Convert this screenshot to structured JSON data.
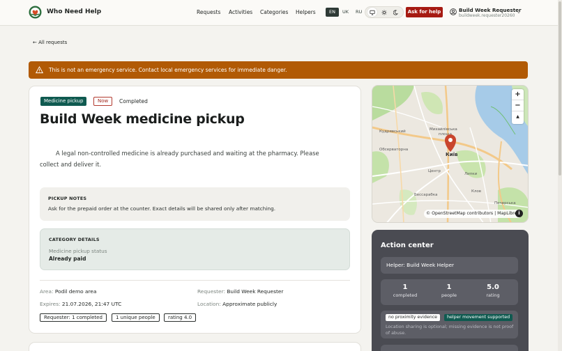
{
  "header": {
    "brand": "Who Need Help",
    "nav": [
      "Requests",
      "Activities",
      "Categories",
      "Helpers"
    ],
    "languages": [
      {
        "code": "EN",
        "active": true
      },
      {
        "code": "UK",
        "active": false
      },
      {
        "code": "RU",
        "active": false
      }
    ],
    "theme_icons": [
      "monitor-icon",
      "sun-icon",
      "moon-icon"
    ],
    "ask_label": "Ask for help",
    "user_name": "Build Week Requester",
    "user_email": "buildweek.requester20260...",
    "accent": "#a61a12"
  },
  "back_link": "← All requests",
  "alert": {
    "text": "This is not an emergency service. Contact local emergency services for immediate danger.",
    "color": "#b15a05"
  },
  "request": {
    "category": "Medicine pickup",
    "urgency": "Now",
    "status": "Completed",
    "title": "Build Week medicine pickup",
    "description": "A legal non-controlled medicine is already purchased and waiting at the pharmacy. Please collect and deliver it.",
    "pickup_notes_heading": "PICKUP NOTES",
    "pickup_notes": "Ask for the prepaid order at the counter. Exact details will be shared only after matching.",
    "category_details_heading": "CATEGORY DETAILS",
    "category_detail_label": "Medicine pickup status",
    "category_detail_value": "Already paid",
    "area_label": "Area:",
    "area_value": "Podil demo area",
    "requester_label": "Requester:",
    "requester_value": "Build Week Requester",
    "expires_label": "Expires:",
    "expires_value": "21.07.2026, 21:47 UTC",
    "location_label": "Location:",
    "location_value": "Approximate publicly",
    "pills": [
      "Requester: 1 completed",
      "1 unique people",
      "rating 4.0"
    ]
  },
  "map": {
    "labels": [
      "Кудрявський",
      "Михайлівська",
      "площа",
      "Обсерваторна",
      "Київ",
      "Центр",
      "Липки",
      "Клов",
      "Печерська",
      "Бессарабка"
    ],
    "zoom_in": "+",
    "zoom_out": "−",
    "reset": "▲",
    "attribution": "© OpenStreetMap contributors | MapLibre",
    "info": "i"
  },
  "action_center": {
    "title": "Action center",
    "helper": "Helper: Build Week Helper",
    "stats": [
      {
        "value": "1",
        "label": "completed"
      },
      {
        "value": "1",
        "label": "people"
      },
      {
        "value": "5.0",
        "label": "rating"
      }
    ],
    "tag_proximity": "no proximity evidence",
    "tag_movement": "helper movement supported",
    "note": "Location sharing is optional; missing evidence is not proof of abuse."
  }
}
